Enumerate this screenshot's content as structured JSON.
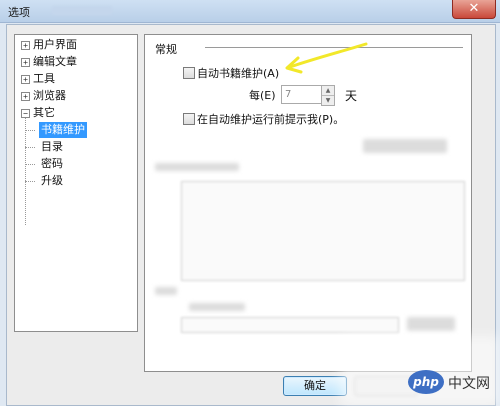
{
  "window": {
    "title": "选项",
    "close_symbol": "✕"
  },
  "tree": {
    "items": [
      {
        "label": "用户界面",
        "expander": "+"
      },
      {
        "label": "编辑文章",
        "expander": "+"
      },
      {
        "label": "工具",
        "expander": "+"
      },
      {
        "label": "浏览器",
        "expander": "+"
      },
      {
        "label": "其它",
        "expander": "−"
      }
    ],
    "children": [
      {
        "label": "书籍维护",
        "selected": true
      },
      {
        "label": "目录",
        "selected": false
      },
      {
        "label": "密码",
        "selected": false
      },
      {
        "label": "升级",
        "selected": false
      }
    ]
  },
  "panel": {
    "section_title": "常规",
    "auto_maintain": {
      "label": "自动书籍维护(A)",
      "checked": false
    },
    "every": {
      "label": "每(E)",
      "value": "7",
      "unit": "天"
    },
    "prompt_before": {
      "label": "在自动维护运行前提示我(P)。",
      "checked": false
    }
  },
  "footer": {
    "ok_label": "确定"
  },
  "watermark": {
    "logo": "php",
    "text": "中文网"
  },
  "colors": {
    "selection": "#3399ff",
    "arrow": "#f2e82a",
    "ok_border": "#3c7fb1"
  },
  "icons": {
    "spin_up": "▲",
    "spin_down": "▼"
  }
}
